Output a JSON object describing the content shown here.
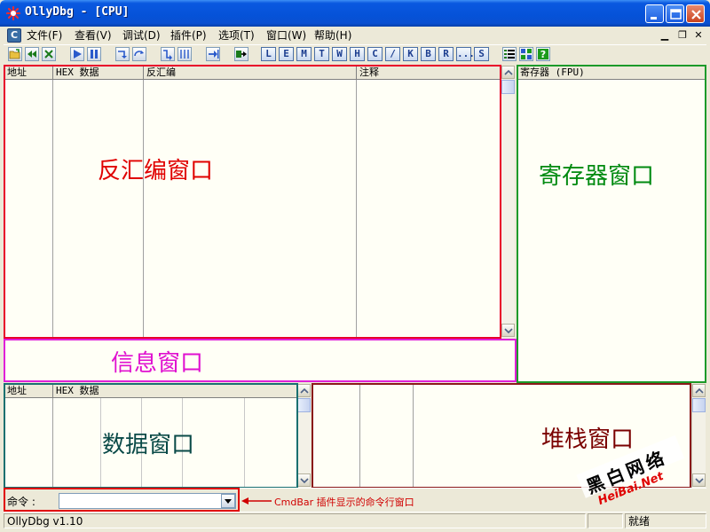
{
  "window": {
    "title": "OllyDbg - [CPU]"
  },
  "menu": [
    "文件(F)",
    "查看(V)",
    "调试(D)",
    "插件(P)",
    "选项(T)",
    "窗口(W)",
    "帮助(H)"
  ],
  "toolbar_letters": [
    "L",
    "E",
    "M",
    "T",
    "W",
    "H",
    "C",
    "/",
    "K",
    "B",
    "R",
    "...",
    "S"
  ],
  "disasm": {
    "columns": [
      "地址",
      "HEX 数据",
      "反汇编",
      "注释"
    ],
    "label": "反汇编窗口",
    "label_color": "#e00000",
    "frame_color": "#e8002a"
  },
  "registers": {
    "header": "寄存器 (FPU)",
    "label": "寄存器窗口",
    "label_color": "#008a10",
    "frame_color": "#1c9a2a"
  },
  "info": {
    "label": "信息窗口",
    "label_color": "#e010d0",
    "frame_color": "#e020d8"
  },
  "dump": {
    "columns": [
      "地址",
      "HEX 数据"
    ],
    "label": "数据窗口",
    "label_color": "#0a4a48",
    "frame_color": "#1a7070"
  },
  "stack": {
    "label": "堆栈窗口",
    "label_color": "#7a0000",
    "frame_color": "#8a1a1a"
  },
  "command": {
    "label": "命令 :",
    "input_value": "",
    "note": "CmdBar 插件显示的命令行窗口",
    "note_color": "#d00000"
  },
  "status": {
    "left": "OllyDbg v1.10",
    "right": "就绪"
  },
  "watermark": {
    "text_top": "黑白网络",
    "text_bottom": "HeiBai.Net"
  }
}
